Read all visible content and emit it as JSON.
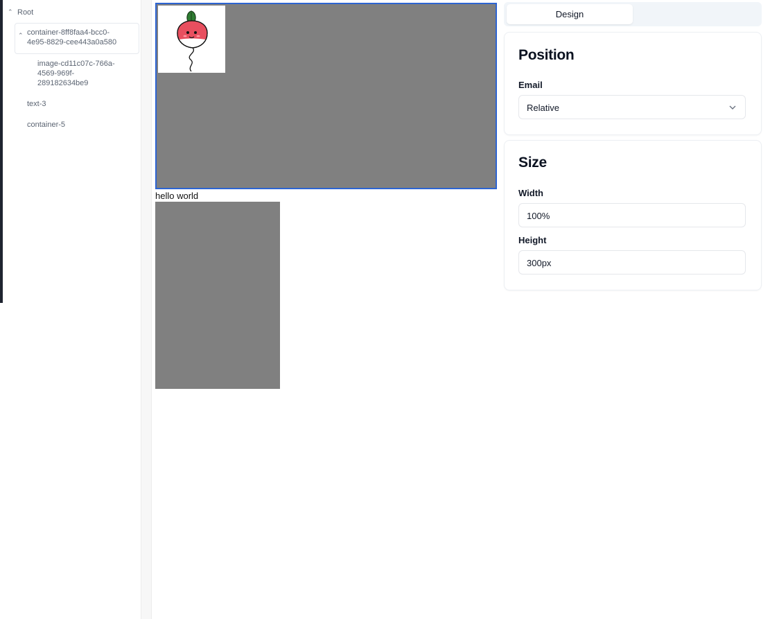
{
  "layers": {
    "root_label": "Root",
    "nodes": [
      {
        "label_line1": "container-8ff8faa4-bcc0-",
        "label_line2": "4e95-8829-cee443a0a580"
      },
      {
        "label_line1": "image-cd11c07c-766a-",
        "label_line2": "4569-969f-",
        "label_line3": "289182634be9"
      },
      {
        "label": "text-3"
      },
      {
        "label": "container-5"
      }
    ]
  },
  "canvas": {
    "text": "hello world",
    "container_color": "#808080",
    "selection_color": "#2d64d2"
  },
  "panel": {
    "tab": "Design",
    "position": {
      "title": "Position",
      "field_label": "Email",
      "select_value": "Relative"
    },
    "size": {
      "title": "Size",
      "width_label": "Width",
      "width_value": "100%",
      "height_label": "Height",
      "height_value": "300px"
    }
  }
}
